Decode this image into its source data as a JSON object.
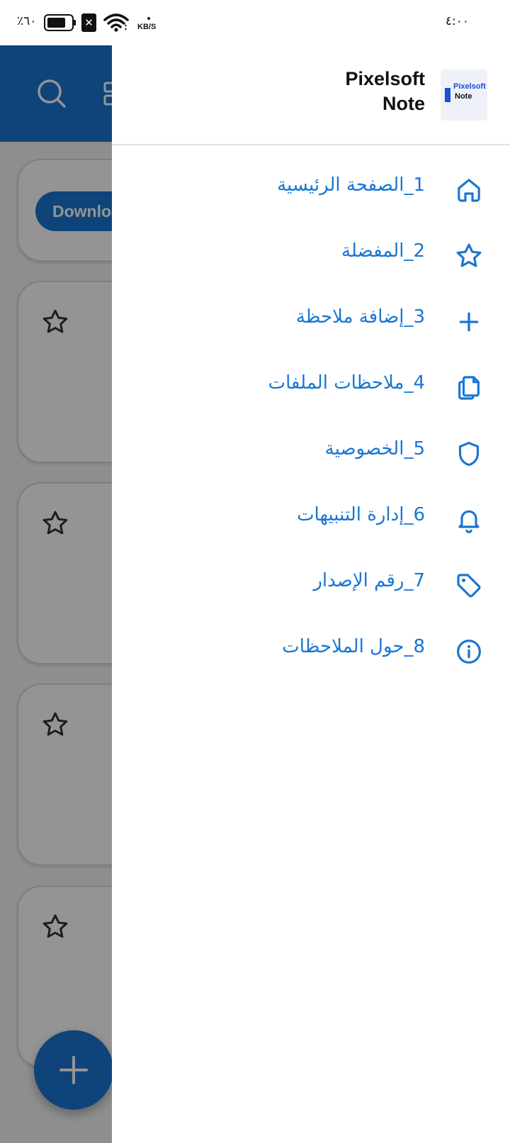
{
  "status_bar": {
    "battery_text": "٪٦٠",
    "network_speed_unit": "KB/S",
    "sim_badge": "✕",
    "time": "٤:٠٠"
  },
  "background_app": {
    "download_button_label": "Download",
    "note_card_count": 4
  },
  "drawer": {
    "app_title_line1": "Pixelsoft",
    "app_title_line2": "Note",
    "logo_text_line1": "Pixelsoft",
    "logo_text_line2": "Note",
    "accent_color": "#1976d2",
    "items": [
      {
        "label": "1_الصفحة الرئيسية",
        "icon": "home-icon"
      },
      {
        "label": "2_المفضلة",
        "icon": "star-icon"
      },
      {
        "label": "3_إضافة ملاحظة",
        "icon": "plus-icon"
      },
      {
        "label": "4_ملاحظات الملفات",
        "icon": "files-icon"
      },
      {
        "label": "5_الخصوصية",
        "icon": "shield-icon"
      },
      {
        "label": "6_إدارة التنبيهات",
        "icon": "bell-icon"
      },
      {
        "label": "7_رقم الإصدار",
        "icon": "tag-icon"
      },
      {
        "label": "8_حول الملاحظات",
        "icon": "info-icon"
      }
    ]
  }
}
